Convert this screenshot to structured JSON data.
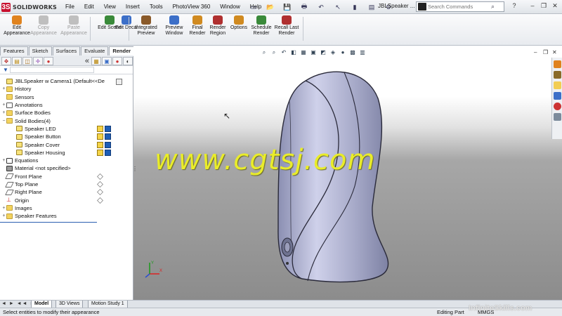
{
  "app": {
    "brand": "SOLIDWORKS",
    "document_title": "JBLSpeaker ..."
  },
  "menu": [
    "File",
    "Edit",
    "View",
    "Insert",
    "Tools",
    "PhotoView 360",
    "Window",
    "Help"
  ],
  "search": {
    "placeholder": "Search Commands"
  },
  "commands": [
    {
      "label": "Edit Appearance",
      "disabled": false,
      "icon": "appearance-sphere-icon",
      "color": "#e0831f"
    },
    {
      "label": "Copy Appearance",
      "disabled": true,
      "icon": "copy-appearance-icon",
      "color": "#bfbfbf"
    },
    {
      "label": "Paste Appearance",
      "disabled": true,
      "icon": "paste-appearance-icon",
      "color": "#bfbfbf"
    },
    {
      "label": "Edit Scene",
      "disabled": false,
      "icon": "scene-icon",
      "color": "#3a8a3a"
    },
    {
      "label": "Edit Decal",
      "disabled": false,
      "icon": "decal-icon",
      "color": "#3c6fc8"
    },
    {
      "label": "Integrated Preview",
      "disabled": false,
      "icon": "integrated-preview-icon",
      "color": "#8a5a2a"
    },
    {
      "label": "Preview Window",
      "disabled": false,
      "icon": "preview-window-icon",
      "color": "#3c6fc8"
    },
    {
      "label": "Final Render",
      "disabled": false,
      "icon": "final-render-icon",
      "color": "#d08a20"
    },
    {
      "label": "Render Region",
      "disabled": false,
      "icon": "render-region-icon",
      "color": "#b03030"
    },
    {
      "label": "Options",
      "disabled": false,
      "icon": "options-gear-icon",
      "color": "#d08a20"
    },
    {
      "label": "Schedule Render",
      "disabled": false,
      "icon": "schedule-render-icon",
      "color": "#3a8a3a"
    },
    {
      "label": "Recall Last Render",
      "disabled": false,
      "icon": "recall-render-icon",
      "color": "#b03030"
    }
  ],
  "tabs": [
    "Features",
    "Sketch",
    "Surfaces",
    "Evaluate",
    "Render Tools"
  ],
  "tree": [
    {
      "label": "JBLSpeaker w Camera1  (Default<<De",
      "icon": "part",
      "exp": ""
    },
    {
      "label": "History",
      "icon": "folder",
      "exp": "+"
    },
    {
      "label": "Sensors",
      "icon": "folder",
      "exp": ""
    },
    {
      "label": "Annotations",
      "icon": "ann",
      "exp": "+"
    },
    {
      "label": "Surface Bodies",
      "icon": "folder",
      "exp": "+"
    },
    {
      "label": "Solid Bodies(4)",
      "icon": "folder",
      "exp": "−"
    },
    {
      "label": "Speaker LED",
      "icon": "part",
      "exp": "",
      "indent": 1
    },
    {
      "label": "Speaker Button",
      "icon": "part",
      "exp": "",
      "indent": 1
    },
    {
      "label": "Speaker Cover",
      "icon": "part",
      "exp": "",
      "indent": 1
    },
    {
      "label": "Speaker Housing",
      "icon": "part",
      "exp": "",
      "indent": 1
    },
    {
      "label": "Equations",
      "icon": "sum",
      "exp": "+"
    },
    {
      "label": "Material <not specified>",
      "icon": "mat",
      "exp": ""
    },
    {
      "label": "Front Plane",
      "icon": "plane",
      "exp": ""
    },
    {
      "label": "Top Plane",
      "icon": "plane",
      "exp": ""
    },
    {
      "label": "Right Plane",
      "icon": "plane",
      "exp": ""
    },
    {
      "label": "Origin",
      "icon": "org",
      "exp": ""
    },
    {
      "label": "Images",
      "icon": "folder",
      "exp": "+"
    },
    {
      "label": "Speaker Features",
      "icon": "folder",
      "exp": "+"
    }
  ],
  "bottom_tabs": [
    "Model",
    "3D Views",
    "Motion Study 1"
  ],
  "status": {
    "left": "Select entities to modify their appearance",
    "mode": "Editing Part",
    "units": "MMGS"
  },
  "watermark": "www.cgtsj.com",
  "brand_watermark": "InfiniteSkills.com",
  "nav_arrows": "◄ ► ◄◄ ►►"
}
